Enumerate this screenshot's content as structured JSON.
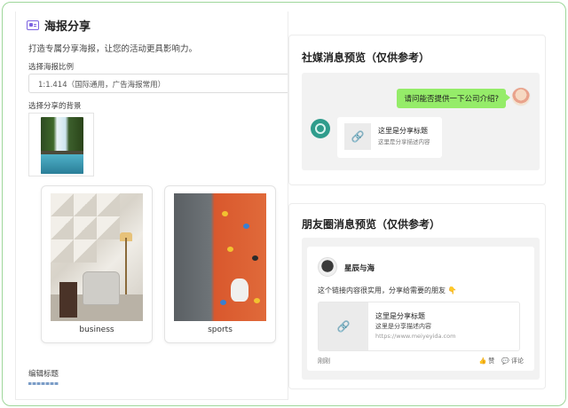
{
  "page": {
    "title": "海报分享",
    "subtitle": "打造专属分享海报，让您的活动更具影响力。"
  },
  "ratio": {
    "label": "选择海报比例",
    "selected": "1:1.414（国际通用，广告海报常用）"
  },
  "background": {
    "label": "选择分享的背景",
    "options": [
      {
        "caption": "business"
      },
      {
        "caption": "sports"
      }
    ]
  },
  "edit": {
    "label": "编辑标题"
  },
  "social_preview": {
    "title": "社媒消息预览（仅供参考）",
    "question": "请问能否提供一下公司介绍?",
    "link_title": "这里是分享标题",
    "link_desc": "这里是分享描述内容"
  },
  "moments_preview": {
    "title": "朋友圈消息预览（仅供参考）",
    "user_name": "星辰与海",
    "post_text": "这个链接内容很实用，分享给需要的朋友 👇",
    "link_title": "这里是分享标题",
    "link_desc": "这里是分享描述内容",
    "link_url": "https://www.meiyeyida.com",
    "time": "刚刚",
    "like_label": "赞",
    "comment_label": "评论"
  },
  "colors": {
    "accent": "#7d63e0",
    "bubble": "#95ec69",
    "frame_border": "#9ed69a"
  }
}
